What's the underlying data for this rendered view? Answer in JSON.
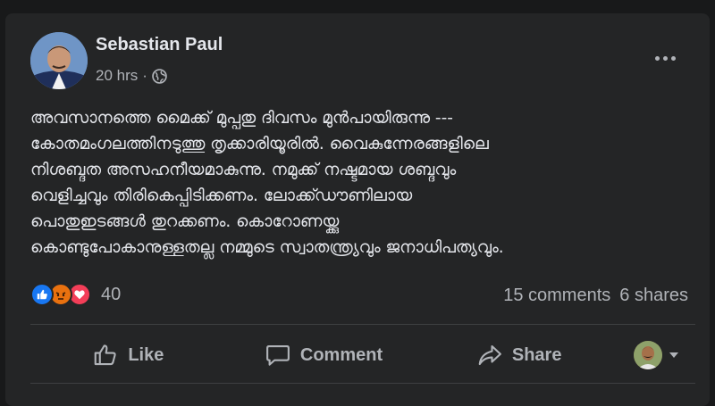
{
  "post": {
    "author": "Sebastian Paul",
    "time": "20 hrs",
    "separator": "·",
    "text_lines": [
      "അവസാനത്തെ മൈക്ക് മുപ്പതു ദിവസം മുൻപായിരുന്നു ---",
      "കോതമംഗലത്തിനടുത്തു തൃക്കാരിയൂരിൽ. വൈകുന്നേരങ്ങളിലെ",
      "നിശബ്ദത അസഹനീയമാകുന്നു. നമുക്ക് നഷ്ടമായ ശബ്ദവും",
      "വെളിച്ചവും തിരികെപ്പിടിക്കണം. ലോക്ക്ഡൗണിലായ",
      "പൊതുഇടങ്ങൾ തുറക്കണം. കൊറോണയ്ക്കു",
      "കൊണ്ടുപോകാനുള്ളതല്ല നമ്മുടെ സ്വാതന്ത്ര്യവും ജനാധിപത്യവും."
    ]
  },
  "reactions": {
    "types": [
      "like-icon",
      "angry-icon",
      "love-icon"
    ],
    "count": "40",
    "comments": "15 comments",
    "shares": "6 shares"
  },
  "actions": {
    "like": "Like",
    "comment": "Comment",
    "share": "Share"
  },
  "colors": {
    "background": "#18191a",
    "card": "#242526",
    "text_primary": "#e4e6eb",
    "text_secondary": "#b0b3b8",
    "like_blue": "#1877f2",
    "angry_orange": "#e9710f",
    "love_red": "#f33e58"
  }
}
